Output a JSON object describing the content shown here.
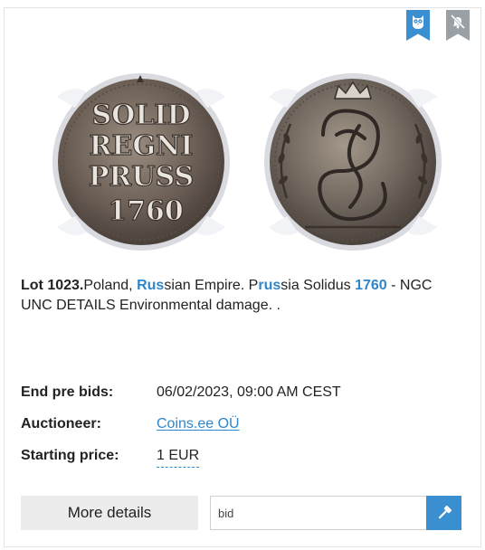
{
  "lot": {
    "lot_label": "Lot 1023.",
    "title_parts": [
      {
        "text": "Poland, ",
        "highlight": false
      },
      {
        "text": "Rus",
        "highlight": true
      },
      {
        "text": "sian Empire. P",
        "highlight": false
      },
      {
        "text": "rus",
        "highlight": true
      },
      {
        "text": "sia Solidus ",
        "highlight": false
      },
      {
        "text": "1760",
        "highlight": true
      },
      {
        "text": " - NGC UNC DETAILS Environmental damage. .",
        "highlight": false
      }
    ]
  },
  "coin": {
    "obverse_legend": [
      "SOLID",
      "REGNI",
      "PRUSS",
      "1760"
    ]
  },
  "details": {
    "end_pre_bids_label": "End pre bids:",
    "end_pre_bids_value": "06/02/2023, 09:00 AM CEST",
    "auctioneer_label": "Auctioneer:",
    "auctioneer_value": "Coins.ee OÜ",
    "starting_price_label": "Starting price:",
    "starting_price_value": "1 EUR"
  },
  "actions": {
    "more_details_label": "More details",
    "bid_placeholder": "bid"
  },
  "colors": {
    "accent": "#3a8fd1",
    "highlight_text": "#2f86c8",
    "badge_muted": "#9aa1a6"
  },
  "icons": {
    "owl_badge": "owl-icon",
    "mute_badge": "bell-off-icon",
    "bid_button": "gavel-icon"
  }
}
